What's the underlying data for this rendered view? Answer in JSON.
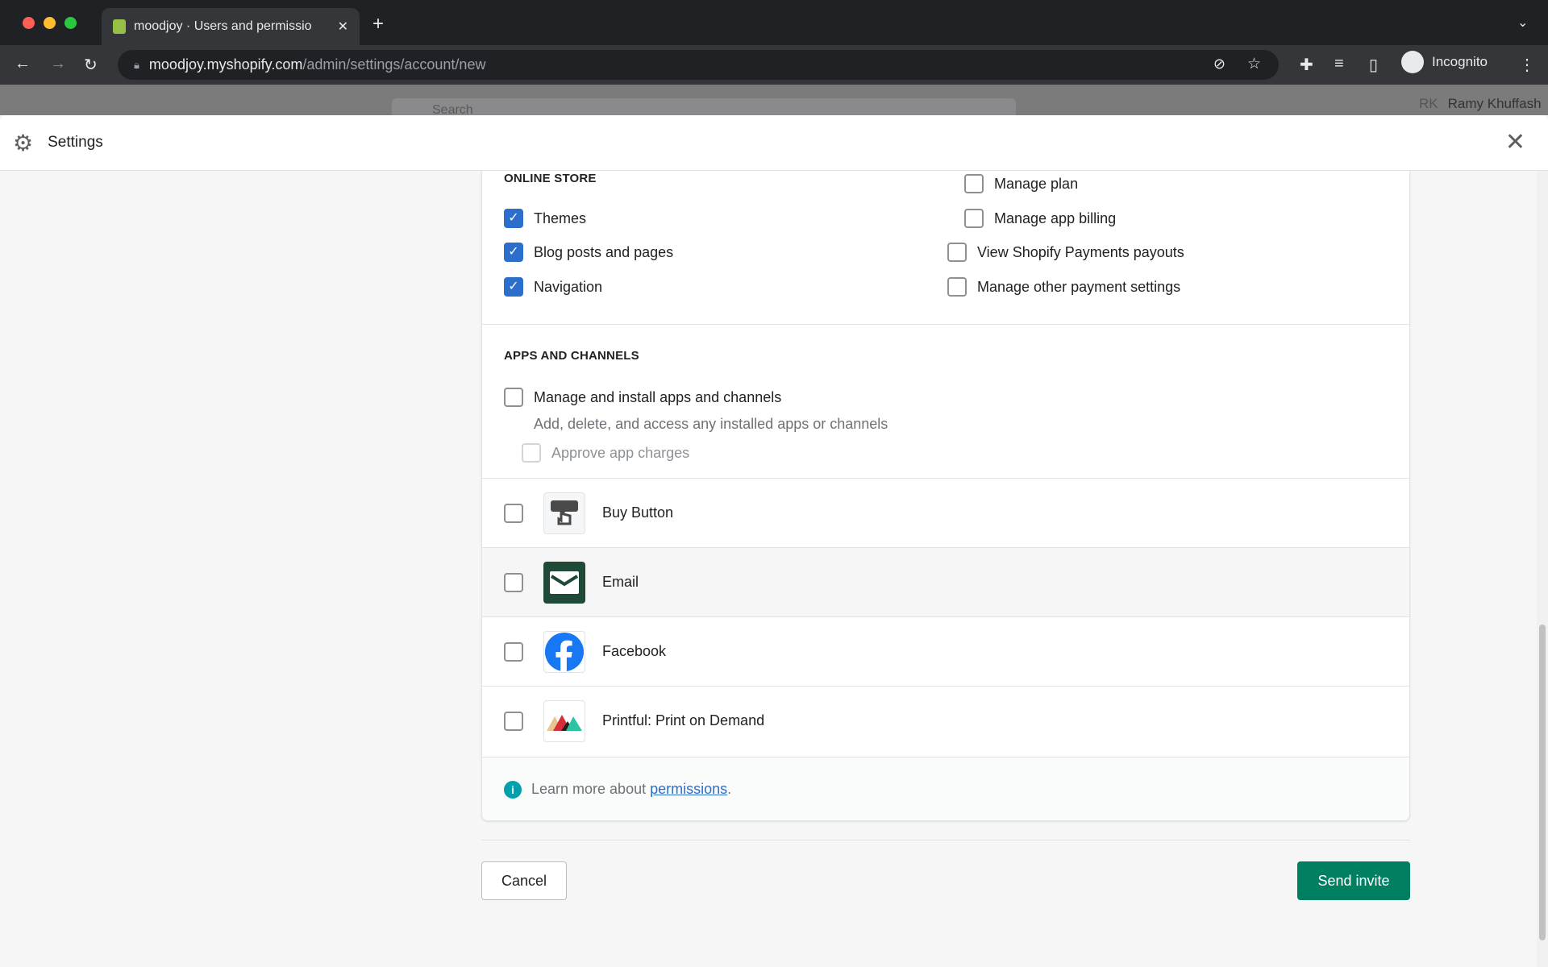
{
  "browser": {
    "tab_title": "moodjoy · Users and permissio",
    "url_host": "moodjoy.myshopify.com",
    "url_path": "/admin/settings/account/new",
    "profile": "Incognito"
  },
  "background": {
    "search_placeholder": "Search",
    "user_initials": "RK",
    "user_name": "Ramy Khuffash"
  },
  "header": {
    "title": "Settings"
  },
  "online_store": {
    "title": "ONLINE STORE",
    "left": [
      {
        "label": "Themes",
        "checked": true
      },
      {
        "label": "Blog posts and pages",
        "checked": true
      },
      {
        "label": "Navigation",
        "checked": true
      }
    ],
    "right": [
      {
        "label": "Manage plan",
        "checked": false
      },
      {
        "label": "Manage app billing",
        "checked": false
      },
      {
        "label": "View Shopify Payments payouts",
        "checked": false
      },
      {
        "label": "Manage other payment settings",
        "checked": false
      }
    ]
  },
  "apps": {
    "title": "APPS AND CHANNELS",
    "manage_label": "Manage and install apps and channels",
    "manage_desc": "Add, delete, and access any installed apps or channels",
    "approve_label": "Approve app charges",
    "items": [
      {
        "label": "Buy Button",
        "icon": "buy-button-icon"
      },
      {
        "label": "Email",
        "icon": "email-icon"
      },
      {
        "label": "Facebook",
        "icon": "facebook-icon"
      },
      {
        "label": "Printful: Print on Demand",
        "icon": "printful-icon"
      }
    ]
  },
  "footer": {
    "learn_text": "Learn more about ",
    "link": "permissions",
    "period": "."
  },
  "actions": {
    "cancel": "Cancel",
    "send": "Send invite"
  },
  "colors": {
    "primary": "#008060",
    "checkbox": "#2c6ecb",
    "link": "#2c6ecb",
    "info": "#00a0ac"
  }
}
